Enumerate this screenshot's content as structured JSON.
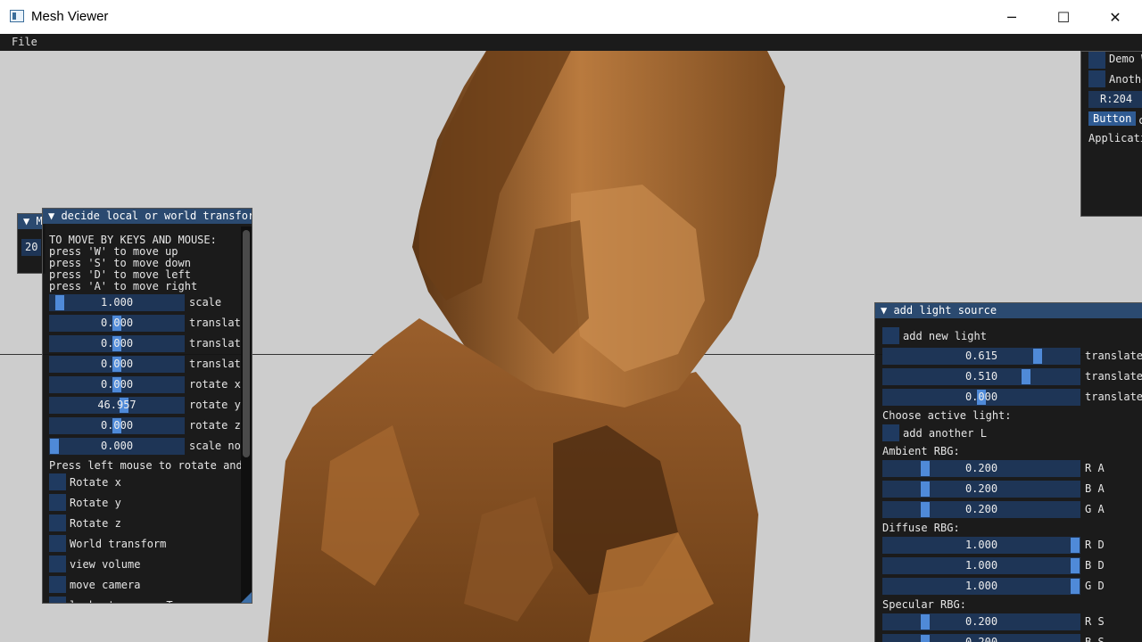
{
  "window": {
    "title": "Mesh Viewer",
    "minimize": "─",
    "maximize": "☐",
    "close": "✕"
  },
  "menubar": {
    "file": "File"
  },
  "small_panel": {
    "title": "M",
    "value": "20"
  },
  "left_panel": {
    "title": "decide local or world transform",
    "help": [
      "TO MOVE BY KEYS AND MOUSE:",
      " press 'W' to move up",
      " press 'S' to move down",
      " press 'D' to move left",
      " press 'A' to move right"
    ],
    "sliders": [
      {
        "value": "1.000",
        "label": "scale",
        "fill": 0.04
      },
      {
        "value": "0.000",
        "label": "translate",
        "fill": 0.5
      },
      {
        "value": "0.000",
        "label": "translate",
        "fill": 0.5
      },
      {
        "value": "0.000",
        "label": "translate",
        "fill": 0.5
      },
      {
        "value": "0.000",
        "label": "rotate x",
        "fill": 0.5
      },
      {
        "value": "46.957",
        "label": "rotate y",
        "fill": 0.56
      },
      {
        "value": "0.000",
        "label": "rotate z",
        "fill": 0.5
      },
      {
        "value": "0.000",
        "label": "scale normals",
        "fill": 0.0
      }
    ],
    "press_text": "Press left mouse to rotate and",
    "checkboxes": [
      "Rotate x",
      "Rotate y",
      "Rotate z",
      "World transform",
      "view volume",
      "move camera",
      "look at camera T"
    ]
  },
  "top_right_panel": {
    "items": [
      "Demo W",
      "Anothe"
    ],
    "color_field": "R:204",
    "button": "Button",
    "button_suffix": "c",
    "footer": "Applicati"
  },
  "light_panel": {
    "title": "add light source",
    "add_new_light": "add new light",
    "sliders": [
      {
        "value": "0.615",
        "label": "translate",
        "fill": 0.8
      },
      {
        "value": "0.510",
        "label": "translate",
        "fill": 0.74
      },
      {
        "value": "0.000",
        "label": "translate",
        "fill": 0.5
      }
    ],
    "choose_label": "Choose active light:",
    "add_another": "add another L",
    "ambient_title": "Ambient RBG:",
    "ambient": [
      {
        "value": "0.200",
        "label": "R A",
        "fill": 0.2
      },
      {
        "value": "0.200",
        "label": "B A",
        "fill": 0.2
      },
      {
        "value": "0.200",
        "label": "G A",
        "fill": 0.2
      }
    ],
    "diffuse_title": "Diffuse RBG:",
    "diffuse": [
      {
        "value": "1.000",
        "label": "R D",
        "fill": 1.0
      },
      {
        "value": "1.000",
        "label": "B D",
        "fill": 1.0
      },
      {
        "value": "1.000",
        "label": "G D",
        "fill": 1.0
      }
    ],
    "specular_title": "Specular RBG:",
    "specular": [
      {
        "value": "0.200",
        "label": "R S",
        "fill": 0.2
      },
      {
        "value": "0.200",
        "label": "B S",
        "fill": 0.2
      }
    ]
  },
  "colors": {
    "accent": "#4f8ad8",
    "frame": "#1e3556",
    "title": "#2b4a70",
    "mesh": "#a8662c"
  }
}
